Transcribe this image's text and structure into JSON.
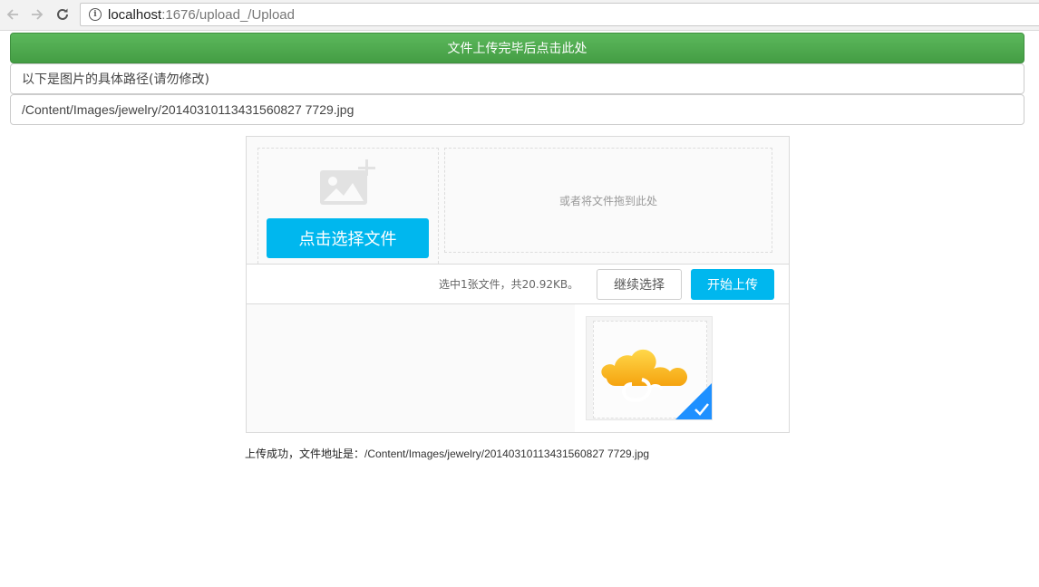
{
  "browser": {
    "url_host": "localhost",
    "url_rest": ":1676/upload_/Upload",
    "back_icon": "arrow-left-icon",
    "forward_icon": "arrow-right-icon",
    "reload_icon": "reload-icon",
    "info_icon": "info-icon"
  },
  "page": {
    "done_button": "文件上传完毕后点击此处",
    "path_note": "以下是图片的具体路径(请勿修改)",
    "path_value": "/Content/Images/jewelry/20140310113431560827 7729.jpg"
  },
  "uploader": {
    "pick_button": "点击选择文件",
    "drop_hint": "或者将文件拖到此处",
    "status_text": "选中1张文件，共20.92KB。",
    "continue_button": "继续选择",
    "start_button": "开始上传",
    "thumb_icon": "cloud-icon",
    "checked_icon": "checkmark-icon"
  },
  "result": {
    "prefix": "上传成功，文件地址是：",
    "path": "/Content/Images/jewelry/20140310113431560827 7729.jpg"
  },
  "colors": {
    "success_green": "#5cb85c",
    "accent_blue": "#00b7ee",
    "check_blue": "#1e90ff"
  }
}
